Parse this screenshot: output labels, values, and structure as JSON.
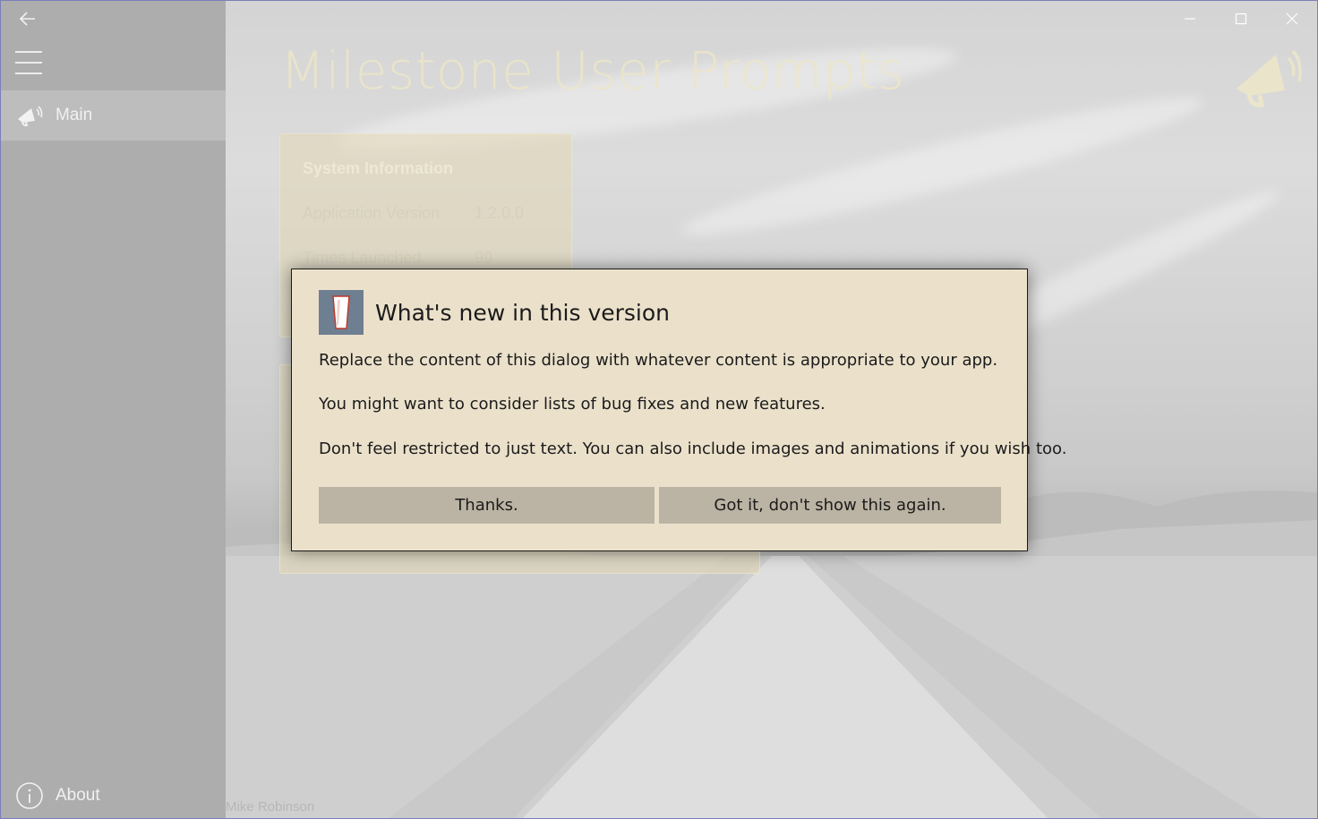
{
  "app": {
    "title": "Milestone User Prompts"
  },
  "sidebar": {
    "items": [
      {
        "label": "Main",
        "icon": "megaphone-icon"
      },
      {
        "label": "About",
        "icon": "info-icon"
      }
    ]
  },
  "system_info": {
    "title": "System Information",
    "rows": [
      {
        "label": "Application Version",
        "value": "1.2.0.0"
      },
      {
        "label": "Times Launched",
        "value": "99"
      }
    ]
  },
  "dialog": {
    "title": "What's new in this version",
    "paragraphs": [
      "Replace the content of this dialog with whatever content is appropriate to your app.",
      "You might want to consider lists of bug fixes and new features.",
      "Don't feel restricted to just text. You can also include images and animations if you wish too."
    ],
    "buttons": {
      "primary": "Thanks.",
      "secondary": "Got it, don't show this again."
    }
  },
  "photo_credit": "Mike Robinson",
  "colors": {
    "title_accent": "#ede6c8",
    "dialog_bg": "#ebe1cb",
    "button_bg": "#bbb3a3",
    "dialog_icon_bg": "#6f7f92",
    "sidebar_bg": "#adadad"
  }
}
